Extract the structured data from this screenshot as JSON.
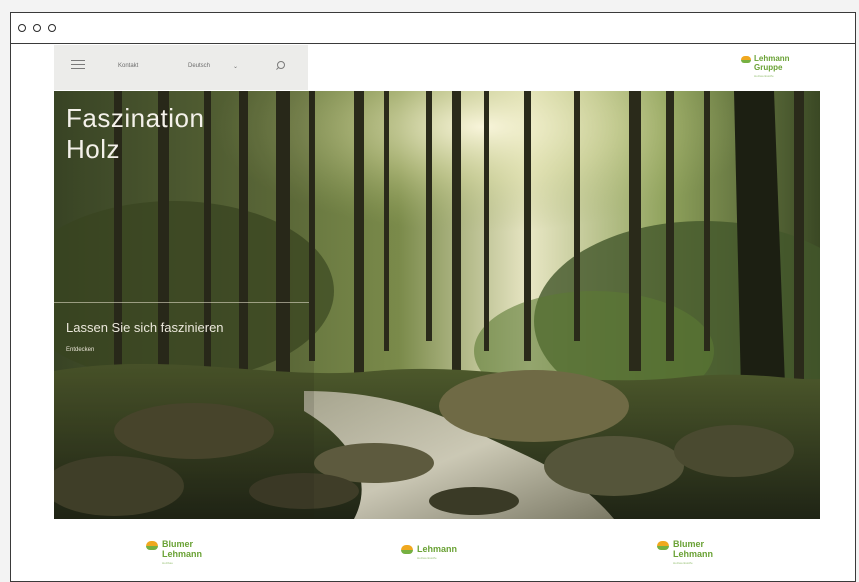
{
  "window": {
    "controls": [
      "close",
      "minimize",
      "maximize"
    ]
  },
  "header": {
    "nav": {
      "menu_icon": "hamburger-icon",
      "contact_label": "Kontakt",
      "language_label": "Deutsch",
      "language_caret": "⌄",
      "search_icon": "search-icon"
    },
    "logo": {
      "line1": "Lehmann",
      "line2": "Gruppe",
      "tagline": "Holzwerkstoffe"
    }
  },
  "hero": {
    "title_line1": "Faszination",
    "title_line2": "Holz",
    "subtitle": "Lassen Sie sich faszinieren",
    "link": "Entdecken"
  },
  "footer_logos": [
    {
      "line1": "Blumer",
      "line2": "Lehmann",
      "tagline": "Holzbau"
    },
    {
      "line1": "Lehmann",
      "line2": "",
      "tagline": "Holzwerkstoffe"
    },
    {
      "line1": "Blumer",
      "line2": "Lehmann",
      "tagline": "Holzwerkstoffe"
    }
  ],
  "colors": {
    "brand_green": "#6aa235",
    "brand_orange": "#f0a81f",
    "nav_bg": "#ececea"
  }
}
